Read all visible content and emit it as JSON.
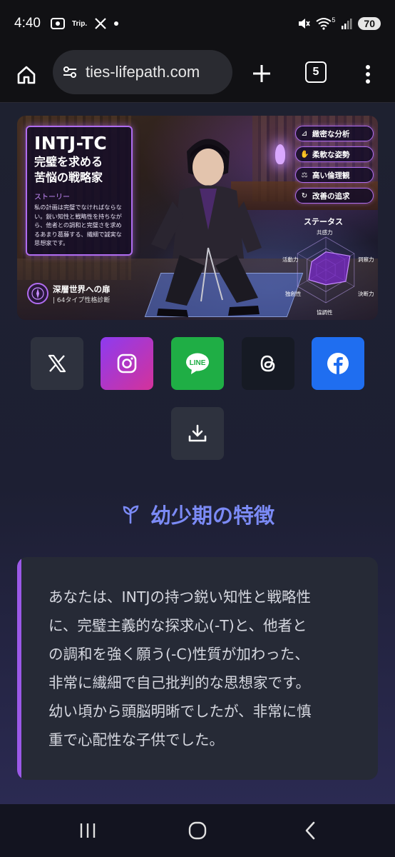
{
  "status_bar": {
    "time": "4:40",
    "trip_label": "Trip.",
    "battery": "70",
    "wifi_badge": "5"
  },
  "browser": {
    "url": "ties-lifepath.com",
    "tab_count": "5"
  },
  "hero": {
    "title": "INTJ-TC",
    "subtitle_line1": "完璧を求める",
    "subtitle_line2": "苦悩の戦略家",
    "story_label": "ストーリー",
    "story_text": "私の計画は完璧でなければならない。鋭い知性と戦略性を持ちながら、他者との調和と完璧さを求めるあまり葛藤する、繊細で誠実な思想家です。",
    "brand_name": "深層世界への扉",
    "brand_sub": "| 64タイプ性格診断",
    "tags": [
      {
        "icon": "ruler-icon",
        "label": "緻密な分析"
      },
      {
        "icon": "handshake-icon",
        "label": "柔軟な姿勢"
      },
      {
        "icon": "scales-icon",
        "label": "高い倫理観"
      },
      {
        "icon": "cycle-icon",
        "label": "改善の追求"
      }
    ],
    "status_title": "ステータス",
    "radar_labels": {
      "top": "共感力",
      "right_top": "洞察力",
      "right_bottom": "決断力",
      "bottom": "協調性",
      "left_bottom": "独創性",
      "left_top": "活動力"
    },
    "radar_values": [
      0.55,
      0.85,
      0.7,
      0.45,
      0.6,
      0.5
    ]
  },
  "share": {
    "buttons": [
      {
        "name": "x",
        "label": "X",
        "color": "#2e323e"
      },
      {
        "name": "instagram",
        "label": "Instagram",
        "color": "#c33aa8"
      },
      {
        "name": "line",
        "label": "LINE",
        "color": "#1fae45"
      },
      {
        "name": "threads",
        "label": "Threads",
        "color": "#161a24"
      },
      {
        "name": "facebook",
        "label": "Facebook",
        "color": "#1f6ef0"
      }
    ],
    "line_text": "LINE"
  },
  "section": {
    "icon": "sprout-icon",
    "title": "幼少期の特徴"
  },
  "childhood": {
    "line1": "あなたは、INTJの持つ鋭い知性と戦略性",
    "line2": "に、完璧主義的な探求心(-T)と、他者と",
    "line3": "の調和を強く願う(-C)性質が加わった、",
    "line4": "非常に繊細で自己批判的な思想家です。",
    "line5": "幼い頃から頭脳明晰でしたが、非常に慎",
    "line6": "重で心配性な子供でした。"
  },
  "colors": {
    "accent": "#9b59e8",
    "heading": "#7b8af5"
  }
}
